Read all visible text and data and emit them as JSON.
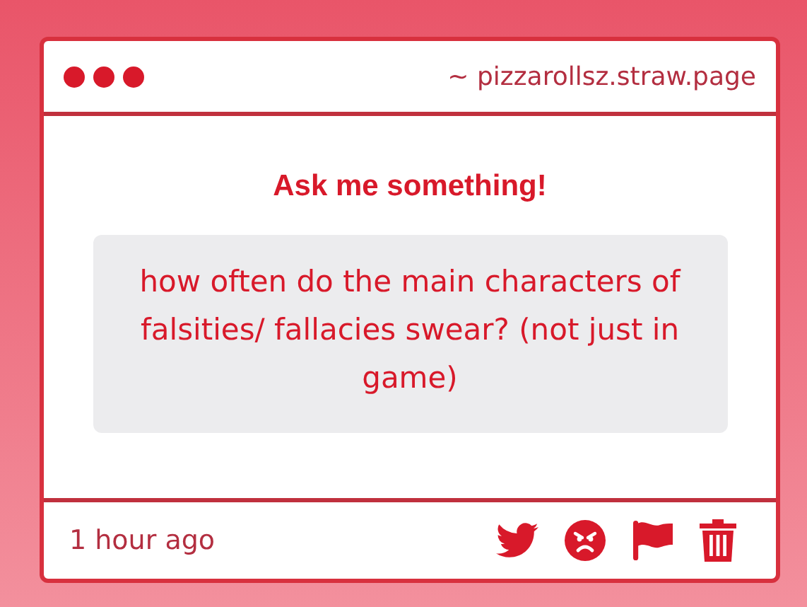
{
  "window": {
    "url": "~ pizzarollsz.straw.page"
  },
  "heading": "Ask me something!",
  "question": "how often do the main characters of falsities/ fallacies swear? (not just in game)",
  "footer": {
    "time": "1 hour ago"
  }
}
